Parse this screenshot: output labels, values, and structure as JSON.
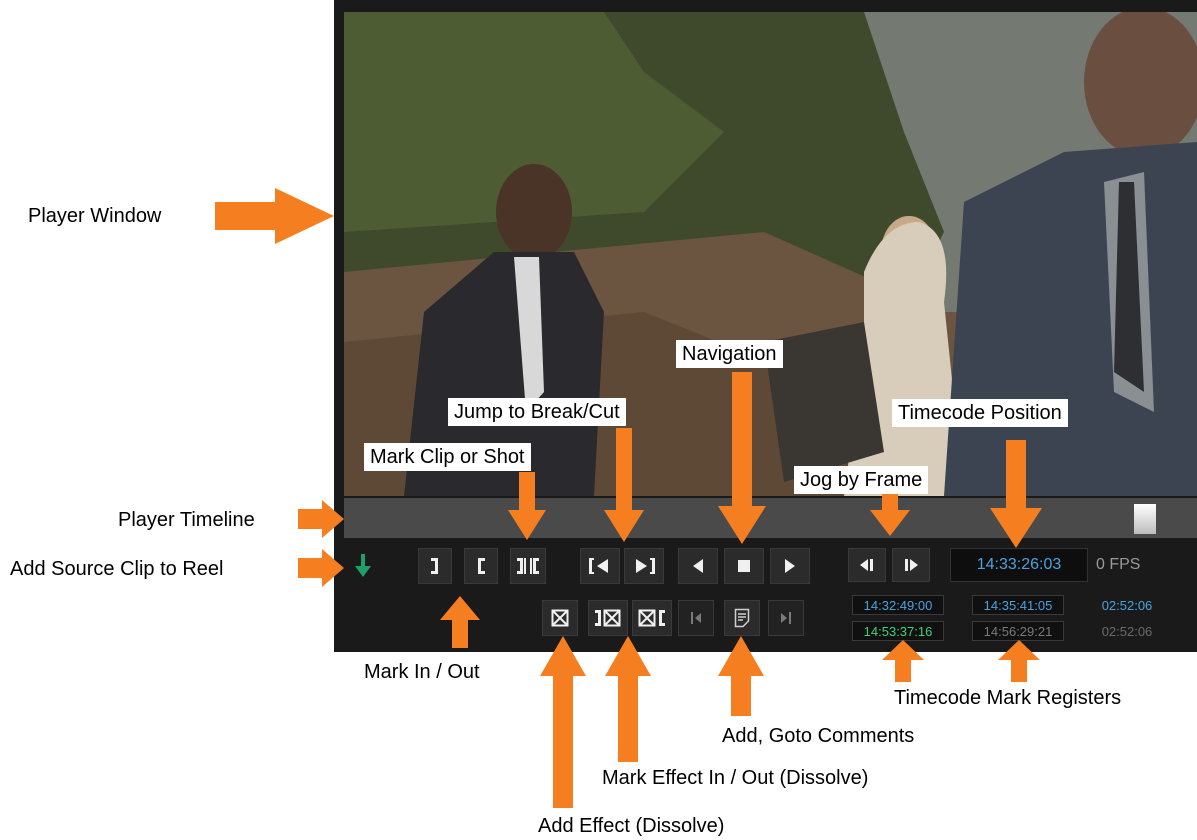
{
  "labels": {
    "player_window": "Player Window",
    "player_timeline": "Player Timeline",
    "add_source_clip": "Add Source Clip to Reel",
    "mark_clip_or_shot": "Mark Clip or Shot",
    "jump_to_break": "Jump to Break/Cut",
    "navigation": "Navigation",
    "timecode_position": "Timecode Position",
    "jog_by_frame": "Jog by Frame",
    "mark_in_out": "Mark In / Out",
    "add_goto_comments": "Add, Goto Comments",
    "timecode_mark_registers": "Timecode Mark Registers",
    "mark_effect_in_out": "Mark Effect In / Out (Dissolve)",
    "add_effect": "Add Effect (Dissolve)"
  },
  "player": {
    "timecode_position": "14:33:26:03",
    "fps": "0 FPS",
    "registers": {
      "in_top": "14:32:49:00",
      "in_bottom": "14:53:37:16",
      "out_top": "14:35:41:05",
      "out_bottom": "14:56:29:21",
      "duration_top": "02:52:06",
      "duration_bottom": "02:52:06"
    }
  },
  "colors": {
    "accent_orange": "#f57f20",
    "timecode_blue": "#4aa3df",
    "timecode_green": "#3fd27a",
    "add_clip_green": "#1f9e6a",
    "player_bg": "#1a1a1a"
  },
  "icons": {
    "add_clip": "down-arrow-icon",
    "mark_in": "bracket-right-icon",
    "mark_out": "bracket-left-icon",
    "mark_clip": "mark-clip-icon",
    "prev_cut": "previous-cut-icon",
    "next_cut": "next-cut-icon",
    "play_reverse": "play-reverse-icon",
    "stop": "stop-icon",
    "play": "play-icon",
    "jog_back": "jog-back-icon",
    "jog_forward": "jog-forward-icon",
    "add_effect": "add-effect-icon",
    "effect_in": "effect-in-icon",
    "effect_out": "effect-out-icon",
    "prev_comment": "previous-comment-icon",
    "comment": "comment-icon",
    "next_comment": "next-comment-icon"
  }
}
